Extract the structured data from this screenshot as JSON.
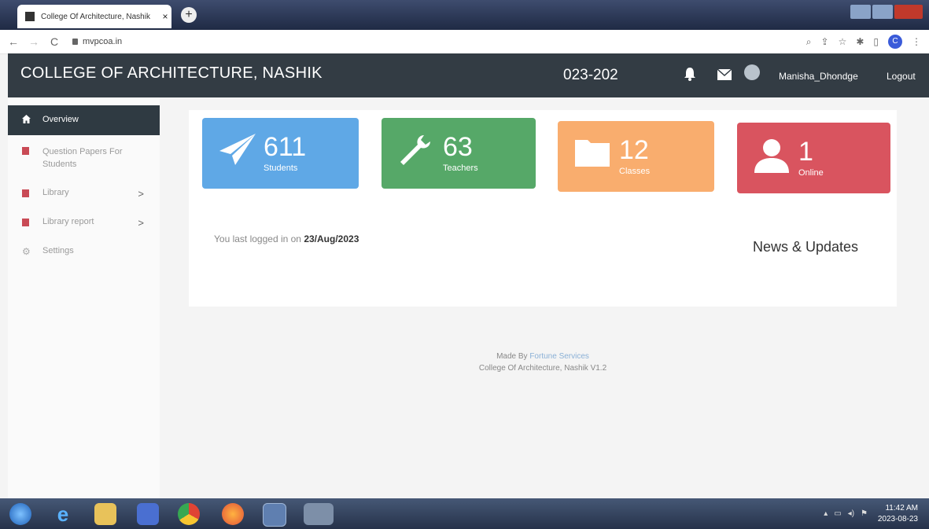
{
  "browser": {
    "tab_title": "College Of Architecture, Nashik",
    "tab_close": "×",
    "new_tab": "+",
    "url": "mvpcoa.in",
    "profile_initial": "C"
  },
  "header": {
    "title": "COLLEGE OF ARCHITECTURE, NASHIK",
    "year": "023-202",
    "username": "Manisha_Dhondge",
    "logout": "Logout"
  },
  "sidebar": {
    "items": [
      {
        "label": "Overview",
        "icon": "home-icon"
      },
      {
        "label": "Question Papers For Students",
        "icon": "book-icon"
      },
      {
        "label": "Library",
        "icon": "table-icon",
        "chevron": ">"
      },
      {
        "label": "Library report",
        "icon": "table-icon",
        "chevron": ">"
      },
      {
        "label": "Settings",
        "icon": "gear-icon"
      }
    ]
  },
  "stats": [
    {
      "value": "611",
      "label": "Students",
      "color": "#5fa8e6",
      "icon": "paper-plane-icon"
    },
    {
      "value": "63",
      "label": "Teachers",
      "color": "#56a868",
      "icon": "wrench-icon"
    },
    {
      "value": "12",
      "label": "Classes",
      "color": "#f9ad6e",
      "icon": "folder-icon"
    },
    {
      "value": "1",
      "label": "Online",
      "color": "#d9545f",
      "icon": "user-icon"
    }
  ],
  "main": {
    "last_login_prefix": "You last logged in on",
    "last_login_date": "23/Aug/2023",
    "news_title": "News & Updates"
  },
  "footer": {
    "made_by": "Made By",
    "company": "Fortune Services",
    "version": "College Of Architecture, Nashik V1.2"
  },
  "taskbar": {
    "time": "11:42 AM",
    "date": "2023-08-23"
  }
}
